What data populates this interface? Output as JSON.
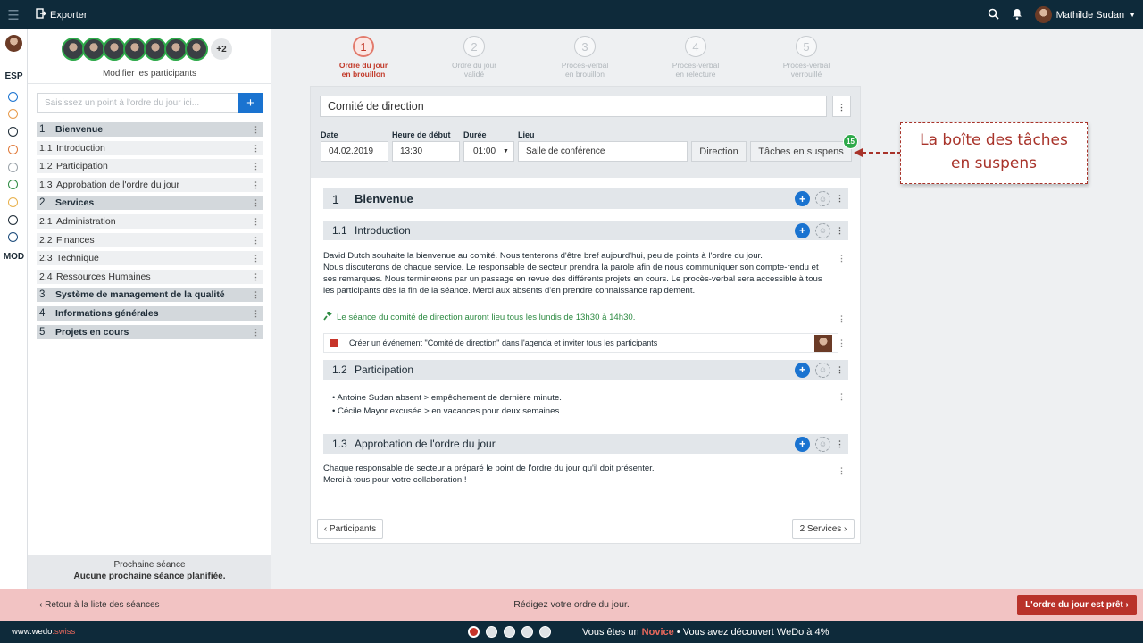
{
  "topbar": {
    "export_label": "Exporter",
    "user_name": "Mathilde Sudan"
  },
  "strip": {
    "esp": "ESP",
    "mod": "MOD"
  },
  "sidebar": {
    "participants_more": "+2",
    "modify_label": "Modifier les participants",
    "add_placeholder": "Saisissez un point à l'ordre du jour ici...",
    "add_button": "+",
    "items": [
      {
        "num": "1",
        "label": "Bienvenue",
        "level": "main"
      },
      {
        "num": "1.1",
        "label": "Introduction",
        "level": "sub"
      },
      {
        "num": "1.2",
        "label": "Participation",
        "level": "sub"
      },
      {
        "num": "1.3",
        "label": "Approbation de l'ordre du jour",
        "level": "sub"
      },
      {
        "num": "2",
        "label": "Services",
        "level": "main"
      },
      {
        "num": "2.1",
        "label": "Administration",
        "level": "sub"
      },
      {
        "num": "2.2",
        "label": "Finances",
        "level": "sub"
      },
      {
        "num": "2.3",
        "label": "Technique",
        "level": "sub"
      },
      {
        "num": "2.4",
        "label": "Ressources Humaines",
        "level": "sub"
      },
      {
        "num": "3",
        "label": "Système de management de la qualité",
        "level": "main"
      },
      {
        "num": "4",
        "label": "Informations générales",
        "level": "main"
      },
      {
        "num": "5",
        "label": "Projets en cours",
        "level": "main"
      }
    ],
    "next_title": "Prochaine séance",
    "next_value": "Aucune prochaine séance planifiée."
  },
  "steps": [
    {
      "num": "1",
      "line1": "Ordre du jour",
      "line2": "en brouillon"
    },
    {
      "num": "2",
      "line1": "Ordre du jour",
      "line2": "validé"
    },
    {
      "num": "3",
      "line1": "Procès-verbal",
      "line2": "en brouillon"
    },
    {
      "num": "4",
      "line1": "Procès-verbal",
      "line2": "en relecture"
    },
    {
      "num": "5",
      "line1": "Procès-verbal",
      "line2": "verrouillé"
    }
  ],
  "meeting": {
    "title": "Comité de direction",
    "labels": {
      "date": "Date",
      "start": "Heure de début",
      "duration": "Durée",
      "place": "Lieu"
    },
    "date": "04.02.2019",
    "start": "13:30",
    "duration": "01:00",
    "place": "Salle de conférence",
    "direction_button": "Direction",
    "tasks_button": "Tâches en suspens",
    "tasks_count": "15"
  },
  "content": {
    "s1": {
      "num": "1",
      "title": "Bienvenue"
    },
    "s11": {
      "num": "1.1",
      "title": "Introduction"
    },
    "intro_p1": "David Dutch souhaite la bienvenue au comité. Nous tenterons d'être bref aujourd'hui, peu de points à l'ordre du jour.",
    "intro_p2": "Nous discuterons de chaque service. Le responsable de secteur prendra la parole afin de nous communiquer son compte-rendu et ses remarques. Nous terminerons par un passage en revue des différents projets en cours. Le procès-verbal sera accessible à tous les participants dès la fin de la séance. Merci aux absents d'en prendre connaissance rapidement.",
    "decision": "Le séance du comité de direction auront lieu tous les lundis de 13h30 à 14h30.",
    "task": "Créer un événement \"Comité de direction\" dans l'agenda et inviter tous les participants",
    "s12": {
      "num": "1.2",
      "title": "Participation"
    },
    "part1": "• Antoine Sudan absent > empêchement de dernière minute.",
    "part2": "• Cécile Mayor excusée > en vacances pour deux semaines.",
    "s13": {
      "num": "1.3",
      "title": "Approbation de l'ordre du jour"
    },
    "appr1": "Chaque responsable de secteur a préparé le point de l'ordre du jour qu'il doit présenter.",
    "appr2": "Merci à tous pour votre collaboration !"
  },
  "nav": {
    "prev": "‹ Participants",
    "next": "2 Services ›"
  },
  "callout": {
    "line1": "La boîte des tâches",
    "line2": "en suspens"
  },
  "footer": {
    "back": "‹  Retour à la liste des séances",
    "message": "Rédigez votre ordre du jour.",
    "ready": "L'ordre du jour est prêt  ›"
  },
  "bottombar": {
    "site_a": "www.wedo",
    "site_b": ".swiss",
    "status_a": "Vous êtes un ",
    "status_level": "Novice",
    "status_b": " • Vous avez découvert WeDo à 4%"
  }
}
